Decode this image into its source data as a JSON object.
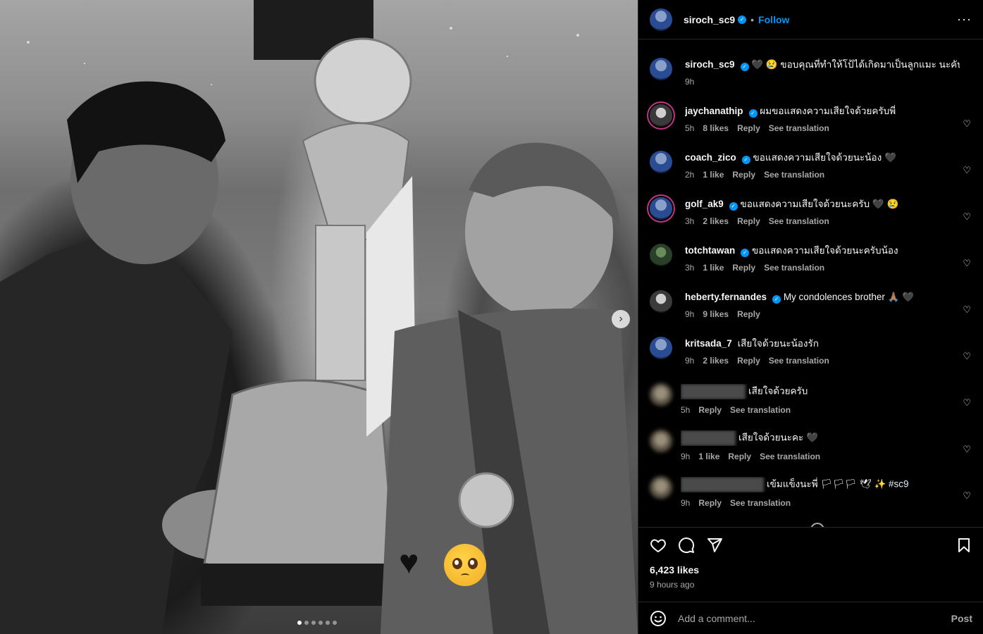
{
  "post": {
    "username": "siroch_sc9",
    "follow_label": "Follow",
    "separator": "•",
    "more_label": "···",
    "likes": "6,423 likes",
    "time": "9 hours ago",
    "media": {
      "sticker_heart": "♥",
      "next_label": "›",
      "slides": 6,
      "active_slide": 1
    }
  },
  "caption": {
    "username": "siroch_sc9",
    "text": "🖤 😢 ขอบคุณที่ทำให้โป้ได้เกิดมาเป็นลูกแมะ นะคับ 😔 🖤",
    "time": "9h"
  },
  "comments": [
    {
      "username": "jaychanathip",
      "verified": true,
      "text": "ผมขอแสดงความเสียใจด้วยครับพี่",
      "time": "5h",
      "likes": "8 likes",
      "reply": "Reply",
      "translate": "See translation"
    },
    {
      "username": "coach_zico",
      "verified": true,
      "text": "ขอแสดงความเสียใจด้วยนะน้อง 🖤",
      "time": "2h",
      "likes": "1 like",
      "reply": "Reply",
      "translate": "See translation"
    },
    {
      "username": "golf_ak9",
      "verified": true,
      "text": "ขอแสดงความเสียใจด้วยนะครับ 🖤 😢",
      "time": "3h",
      "likes": "2 likes",
      "reply": "Reply",
      "translate": "See translation"
    },
    {
      "username": "totchtawan",
      "verified": true,
      "text": "ขอแสดงความเสียใจด้วยนะครับน้อง",
      "time": "3h",
      "likes": "1 like",
      "reply": "Reply",
      "translate": "See translation"
    },
    {
      "username": "heberty.fernandes",
      "verified": true,
      "text": "My condolences brother 🙏🏽 🖤",
      "time": "9h",
      "likes": "9 likes",
      "reply": "Reply",
      "translate": ""
    },
    {
      "username": "kritsada_7",
      "verified": false,
      "text": "เสียใจด้วยนะน้องรัก",
      "time": "9h",
      "likes": "2 likes",
      "reply": "Reply",
      "translate": "See translation"
    },
    {
      "username": "",
      "verified": false,
      "text": "เสียใจด้วยครับ",
      "time": "5h",
      "likes": "",
      "reply": "Reply",
      "translate": "See translation"
    },
    {
      "username": "",
      "verified": false,
      "text": "เสียใจด้วยนะคะ 🖤",
      "time": "9h",
      "likes": "1 like",
      "reply": "Reply",
      "translate": "See translation"
    },
    {
      "username": "",
      "verified": false,
      "text": "เข้มแข็งนะพี่ 🏳🏳🏳 🕊 ✨",
      "hashtag": "#sc9",
      "time": "9h",
      "likes": "",
      "reply": "Reply",
      "translate": "See translation"
    }
  ],
  "composer": {
    "placeholder": "Add a comment...",
    "post_label": "Post"
  },
  "icons": {
    "heart": "heart-icon",
    "comment": "comment-icon",
    "share": "send-icon",
    "save": "bookmark-icon",
    "emoji": "emoji-icon",
    "verified": "verified-badge-icon"
  },
  "colors": {
    "accent": "#0095f6",
    "background": "#000000",
    "muted": "#a8a8a8"
  }
}
